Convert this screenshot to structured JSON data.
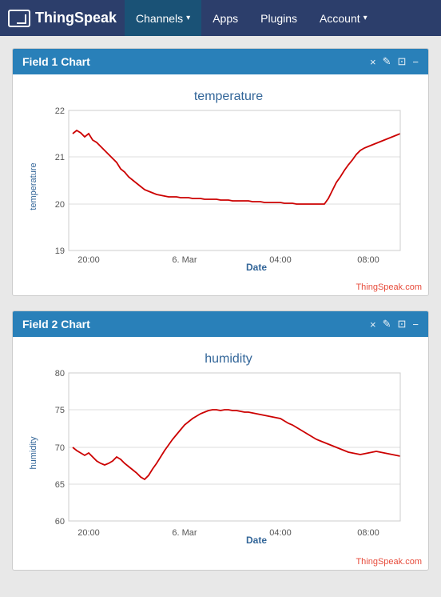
{
  "nav": {
    "logo": "ThingSpeak",
    "items": [
      {
        "label": "Channels",
        "hasCaret": true,
        "active": true
      },
      {
        "label": "Apps",
        "hasCaret": false,
        "active": false
      },
      {
        "label": "Plugins",
        "hasCaret": false,
        "active": false
      },
      {
        "label": "Account",
        "hasCaret": true,
        "active": false
      }
    ]
  },
  "charts": [
    {
      "id": "field1",
      "header": "Field 1 Chart",
      "title": "temperature",
      "ylabel": "temperature",
      "xlabel": "Date",
      "ymin": 19,
      "ymax": 22,
      "yticks": [
        19,
        20,
        21,
        22
      ],
      "xticks": [
        "20:00",
        "6. Mar",
        "04:00",
        "08:00"
      ],
      "attribution": "ThingSpeak.com",
      "color": "#cc0000"
    },
    {
      "id": "field2",
      "header": "Field 2 Chart",
      "title": "humidity",
      "ylabel": "humidity",
      "xlabel": "Date",
      "ymin": 60,
      "ymax": 80,
      "yticks": [
        60,
        65,
        70,
        75,
        80
      ],
      "xticks": [
        "20:00",
        "6. Mar",
        "04:00",
        "08:00"
      ],
      "attribution": "ThingSpeak.com",
      "color": "#cc0000"
    }
  ],
  "controls": [
    "×",
    "✎",
    "⊟",
    "−"
  ]
}
